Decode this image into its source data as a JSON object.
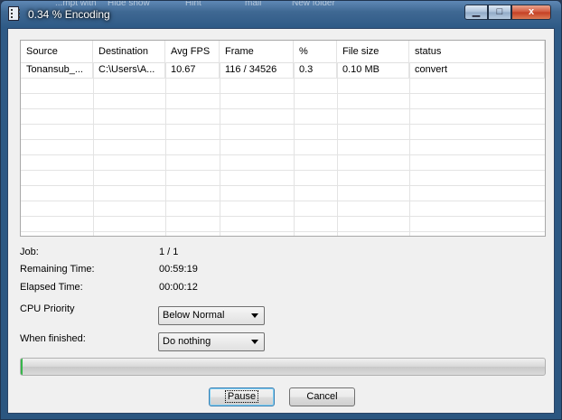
{
  "window": {
    "title": "0.34 % Encoding",
    "background_snippets": [
      "...mpt with",
      "Hide show",
      "Hint",
      "mail",
      "New folder"
    ],
    "controls": {
      "minimize": "▁",
      "maximize": "□",
      "close": "x"
    },
    "colors": {
      "title_bar": "#2e5a86",
      "close_button": "#c43e22",
      "progress_fill": "#37b64b"
    }
  },
  "table": {
    "columns": [
      "Source",
      "Destination",
      "Avg FPS",
      "Frame",
      "%",
      "File size",
      "status"
    ],
    "rows": [
      [
        "Tonansub_...",
        "C:\\Users\\A...",
        "10.67",
        "116 / 34526",
        "0.3",
        "0.10 MB",
        "convert"
      ]
    ]
  },
  "info": {
    "job_label": "Job:",
    "job_value": "1 / 1",
    "remaining_label": "Remaining Time:",
    "remaining_value": "00:59:19",
    "elapsed_label": "Elapsed Time:",
    "elapsed_value": "00:00:12",
    "cpu_priority_label": "CPU Priority",
    "cpu_priority_value": "Below Normal",
    "when_finished_label": "When finished:",
    "when_finished_value": "Do nothing"
  },
  "progress": {
    "fraction": 0.0034
  },
  "buttons": {
    "pause": "Pause",
    "cancel": "Cancel"
  }
}
